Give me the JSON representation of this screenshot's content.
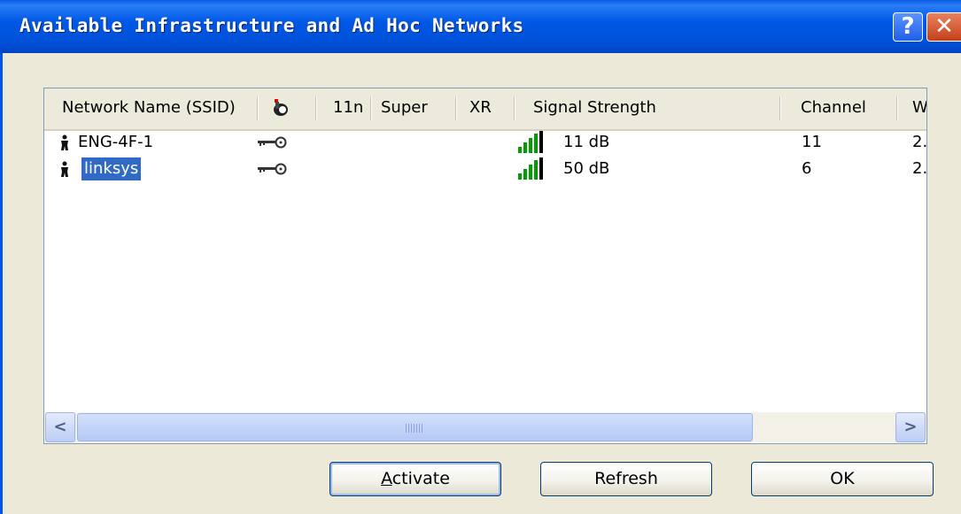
{
  "window": {
    "title": "Available Infrastructure and Ad Hoc Networks",
    "help_label": "?",
    "close_label": "✕"
  },
  "list": {
    "columns": [
      "Network Name (SSID)",
      "",
      "11n",
      "Super",
      "XR",
      "Signal Strength",
      "Channel",
      "W"
    ],
    "icons": {
      "security_column": "lock-key-icon",
      "network_type": "infrastructure-person-icon",
      "security": "key-icon",
      "signal": "signal-bars-icon"
    },
    "rows": [
      {
        "ssid": "ENG-4F-1",
        "signal": "11 dB",
        "channel": "11",
        "w": "2.",
        "selected": false
      },
      {
        "ssid": "linksys",
        "signal": "50 dB",
        "channel": "6",
        "w": "2.",
        "selected": true
      }
    ]
  },
  "buttons": {
    "activate": "Activate",
    "refresh": "Refresh",
    "ok": "OK"
  },
  "colors": {
    "titlebar": "#0055e5",
    "selection": "#316ac5",
    "signal_green": "#00a000"
  }
}
